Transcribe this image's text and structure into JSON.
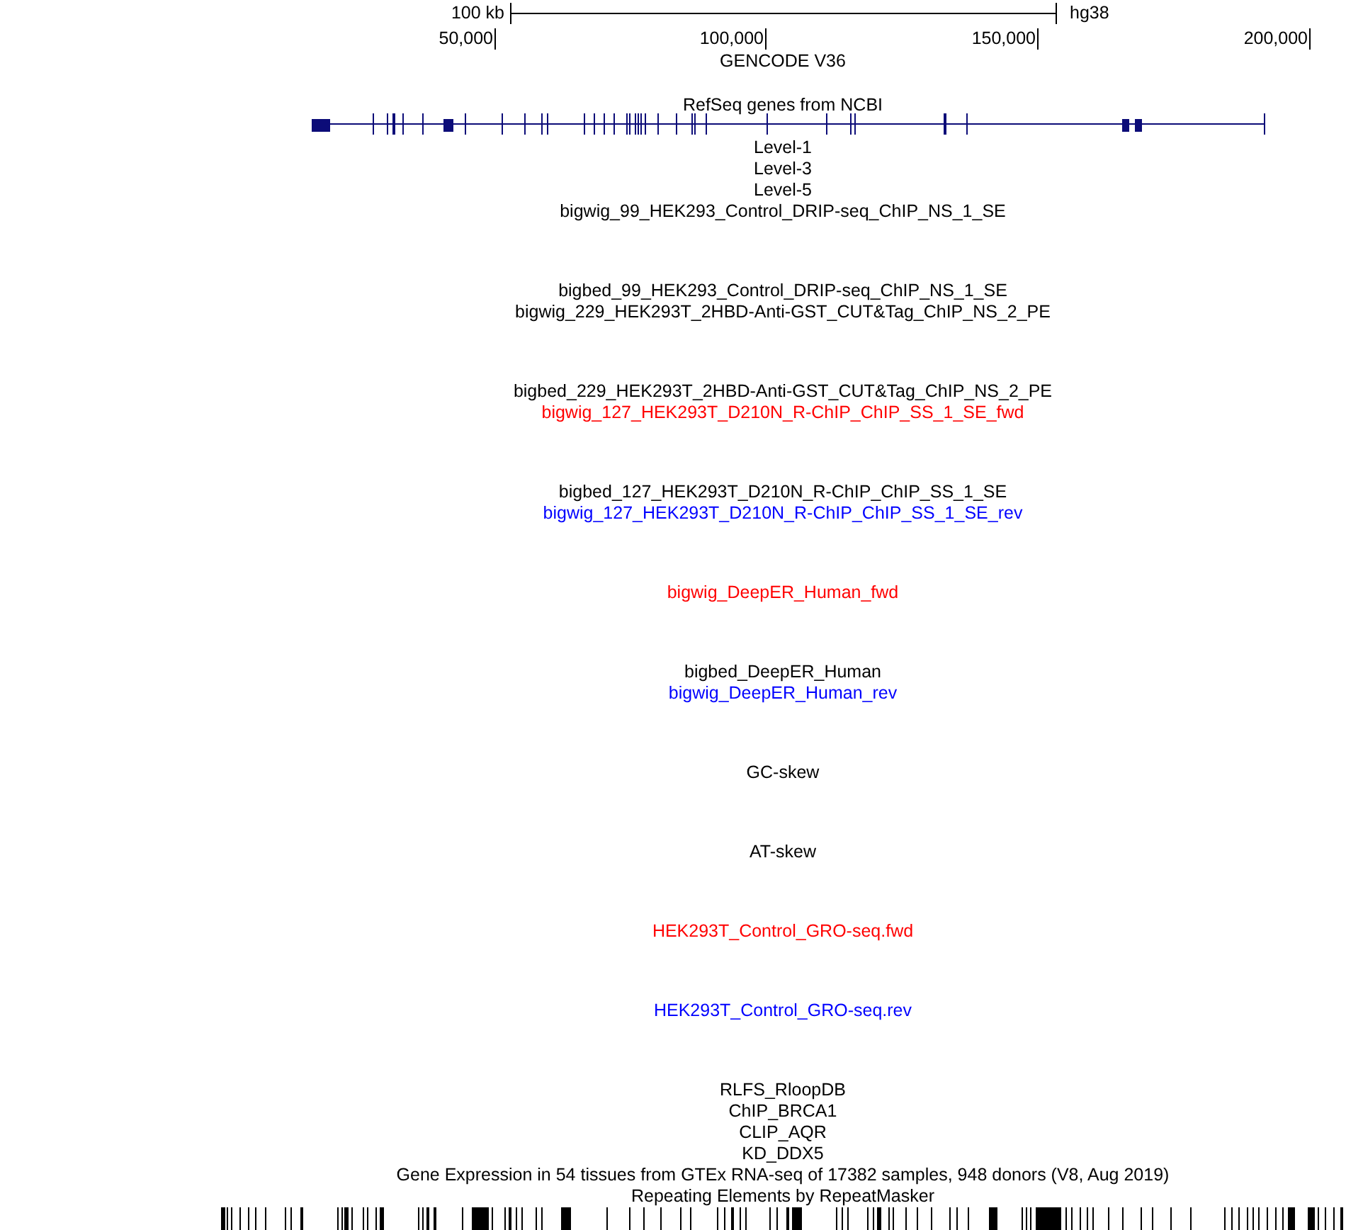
{
  "scale_bar": {
    "label": "100 kb",
    "assembly": "hg38"
  },
  "ruler": {
    "ticks": [
      "50,000",
      "100,000",
      "150,000",
      "200,000"
    ]
  },
  "tracks": [
    {
      "label": "GENCODE V36",
      "kind": "pack",
      "color": "#000000"
    },
    {
      "label": "RefSeq genes from NCBI",
      "kind": "genes",
      "color": "#000000"
    },
    {
      "label": "Level-1",
      "kind": "bed",
      "color": "#000000"
    },
    {
      "label": "Level-3",
      "kind": "bed",
      "color": "#000000"
    },
    {
      "label": "Level-5",
      "kind": "bed",
      "color": "#000000"
    },
    {
      "label": "bigwig_99_HEK293_Control_DRIP-seq_ChIP_NS_1_SE",
      "kind": "wiggle",
      "color": "#000000"
    },
    {
      "label": "bigbed_99_HEK293_Control_DRIP-seq_ChIP_NS_1_SE",
      "kind": "bed",
      "color": "#000000"
    },
    {
      "label": "bigwig_229_HEK293T_2HBD-Anti-GST_CUT&Tag_ChIP_NS_2_PE",
      "kind": "wiggle",
      "color": "#000000"
    },
    {
      "label": "bigbed_229_HEK293T_2HBD-Anti-GST_CUT&Tag_ChIP_NS_2_PE",
      "kind": "bed",
      "color": "#000000"
    },
    {
      "label": "bigwig_127_HEK293T_D210N_R-ChIP_ChIP_SS_1_SE_fwd",
      "kind": "wiggle",
      "color": "#ff0000"
    },
    {
      "label": "bigbed_127_HEK293T_D210N_R-ChIP_ChIP_SS_1_SE",
      "kind": "bed",
      "color": "#000000"
    },
    {
      "label": "bigwig_127_HEK293T_D210N_R-ChIP_ChIP_SS_1_SE_rev",
      "kind": "wiggle",
      "color": "#0000ff"
    },
    {
      "label": "bigwig_DeepER_Human_fwd",
      "kind": "wiggle",
      "color": "#ff0000"
    },
    {
      "label": "bigbed_DeepER_Human",
      "kind": "bed",
      "color": "#000000"
    },
    {
      "label": "bigwig_DeepER_Human_rev",
      "kind": "wiggle",
      "color": "#0000ff"
    },
    {
      "label": "GC-skew",
      "kind": "wiggle",
      "color": "#000000"
    },
    {
      "label": "AT-skew",
      "kind": "wiggle",
      "color": "#000000"
    },
    {
      "label": "HEK293T_Control_GRO-seq.fwd",
      "kind": "wiggle",
      "color": "#ff0000"
    },
    {
      "label": "HEK293T_Control_GRO-seq.rev",
      "kind": "wiggle",
      "color": "#0000ff"
    },
    {
      "label": "RLFS_RloopDB",
      "kind": "bed",
      "color": "#000000"
    },
    {
      "label": "ChIP_BRCA1",
      "kind": "bed",
      "color": "#000000"
    },
    {
      "label": "CLIP_AQR",
      "kind": "bed",
      "color": "#000000"
    },
    {
      "label": "KD_DDX5",
      "kind": "bed",
      "color": "#000000"
    },
    {
      "label": "Gene Expression in 54 tissues from GTEx RNA-seq of 17382 samples, 948 donors (V8, Aug 2019)",
      "kind": "bed",
      "color": "#000000"
    },
    {
      "label": "Repeating Elements by RepeatMasker",
      "kind": "repeats",
      "color": "#000000"
    }
  ]
}
